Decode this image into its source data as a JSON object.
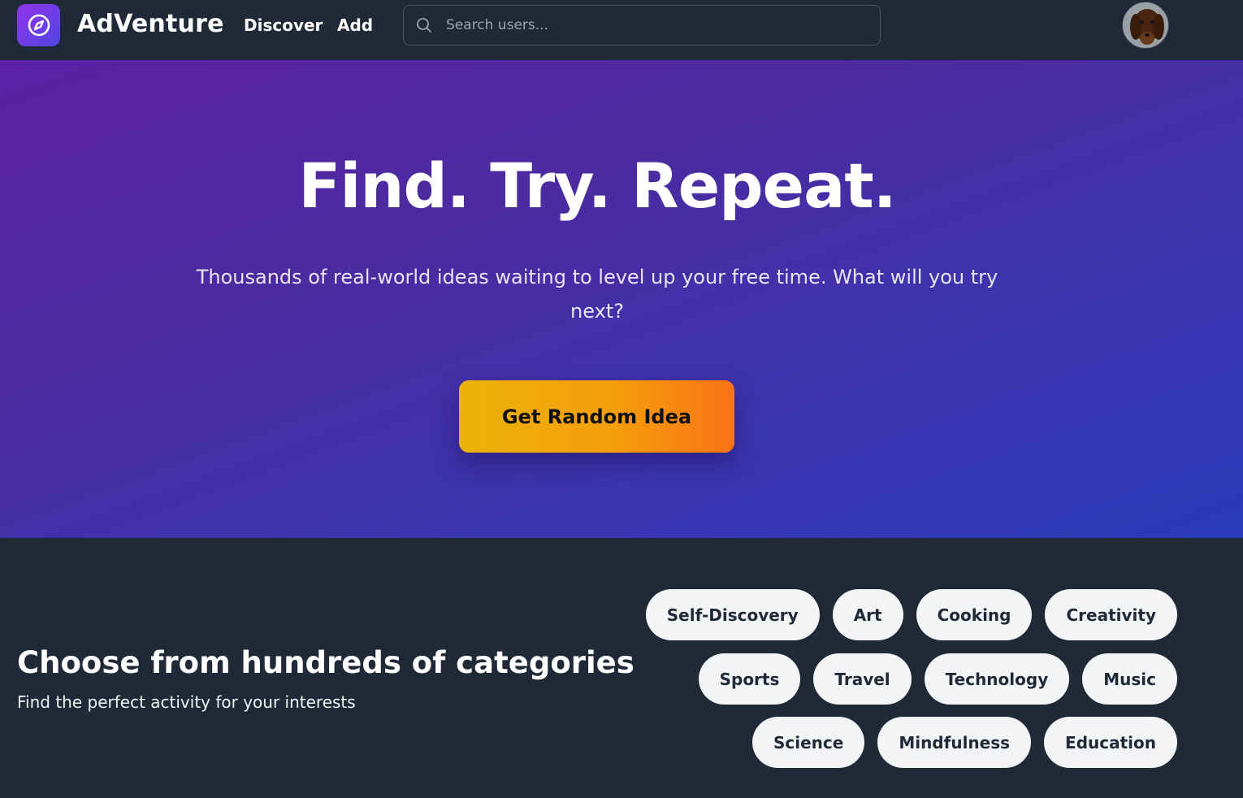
{
  "header": {
    "brand": "AdVenture",
    "nav": [
      {
        "label": "Discover"
      },
      {
        "label": "Add"
      }
    ],
    "search": {
      "placeholder": "Search users...",
      "value": ""
    },
    "logo_icon": "compass-icon",
    "avatar_icon": "user-avatar"
  },
  "hero": {
    "title": "Find. Try. Repeat.",
    "subtitle": "Thousands of real-world ideas waiting to level up your free time. What will you try next?",
    "cta_label": "Get Random Idea",
    "gradient_colors": [
      "#5b21a6",
      "#2a3ab8"
    ],
    "cta_colors": [
      "#eab308",
      "#f97316"
    ]
  },
  "categories": {
    "title": "Choose from hundreds of categories",
    "subtitle": "Find the perfect activity for your interests",
    "rows": [
      [
        "Self-Discovery",
        "Art",
        "Cooking",
        "Creativity"
      ],
      [
        "Sports",
        "Travel",
        "Technology",
        "Music"
      ],
      [
        "Science",
        "Mindfulness",
        "Education"
      ]
    ]
  },
  "colors": {
    "background": "#1f2937",
    "chip_bg": "#f3f4f6",
    "chip_text": "#1f2937"
  }
}
